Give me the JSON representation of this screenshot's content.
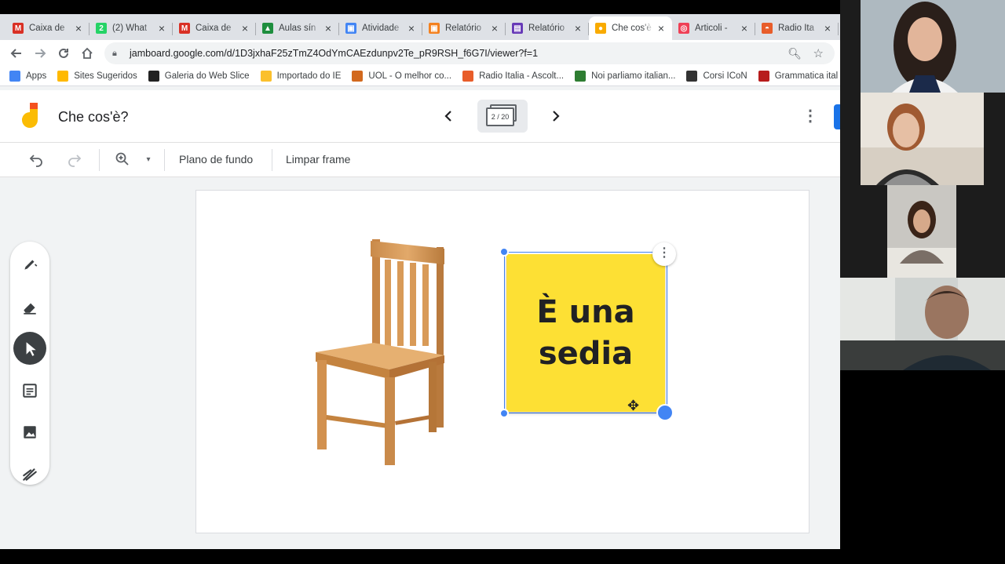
{
  "browser": {
    "tabs": [
      {
        "title": "Caixa de",
        "icon": "gmail-icon",
        "color": "#d93025",
        "glyph": "M",
        "active": false
      },
      {
        "title": "(2) What",
        "icon": "whatsapp-icon",
        "color": "#25d366",
        "glyph": "2",
        "active": false
      },
      {
        "title": "Caixa de",
        "icon": "gmail-icon",
        "color": "#d93025",
        "glyph": "M",
        "active": false
      },
      {
        "title": "Aulas sín",
        "icon": "drive-icon",
        "color": "#1e8e3e",
        "glyph": "▲",
        "active": false
      },
      {
        "title": "Atividade",
        "icon": "classroom-icon",
        "color": "#4285f4",
        "glyph": "▣",
        "active": false
      },
      {
        "title": "Relatório",
        "icon": "slides-icon",
        "color": "#f4811f",
        "glyph": "▣",
        "active": false
      },
      {
        "title": "Relatório",
        "icon": "forms-icon",
        "color": "#673ab7",
        "glyph": "▤",
        "active": false
      },
      {
        "title": "Che cos'è",
        "icon": "jamboard-icon",
        "color": "#f9ab00",
        "glyph": "●",
        "active": true
      },
      {
        "title": "Articoli -",
        "icon": "pocket-icon",
        "color": "#ef4056",
        "glyph": "◎",
        "active": false
      },
      {
        "title": "Radio Ita",
        "icon": "radio-italia-icon",
        "color": "#e85d2a",
        "glyph": "◓",
        "active": false
      }
    ],
    "url": "jamboard.google.com/d/1D3jxhaF25zTmZ4OdYmCAEzdunpv2Te_pR9RSH_f6G7I/viewer?f=1",
    "bookmarks": [
      {
        "label": "Apps",
        "icon": "apps-grid-icon",
        "color": "#4285f4"
      },
      {
        "label": "Sites Sugeridos",
        "icon": "bing-icon",
        "color": "#ffb900"
      },
      {
        "label": "Galeria do Web Slice",
        "icon": "web-slice-icon",
        "color": "#222222"
      },
      {
        "label": "Importado do IE",
        "icon": "folder-icon",
        "color": "#fbc02d"
      },
      {
        "label": "UOL - O melhor co...",
        "icon": "uol-icon",
        "color": "#d2691e"
      },
      {
        "label": "Radio Italia - Ascolt...",
        "icon": "radio-italia-icon",
        "color": "#e85d2a"
      },
      {
        "label": "Noi parliamo italian...",
        "icon": "leaf-icon",
        "color": "#2e7d32"
      },
      {
        "label": "Corsi ICoN",
        "icon": "globe-icon",
        "color": "#333333"
      },
      {
        "label": "Grammatica ital",
        "icon": "grammar-icon",
        "color": "#b71c1c"
      }
    ]
  },
  "jamboard": {
    "title": "Che cos'è?",
    "frame_counter": "2 / 20",
    "toolbar": {
      "background_label": "Plano de fundo",
      "clear_label": "Limpar frame"
    },
    "sticky_note": {
      "text": "È una\nsedia",
      "color": "#fde034"
    },
    "tools": [
      {
        "name": "pen-tool-icon",
        "selected": false
      },
      {
        "name": "eraser-tool-icon",
        "selected": false
      },
      {
        "name": "select-tool-icon",
        "selected": true
      },
      {
        "name": "sticky-note-tool-icon",
        "selected": false
      },
      {
        "name": "image-tool-icon",
        "selected": false
      },
      {
        "name": "laser-tool-icon",
        "selected": false
      }
    ]
  },
  "colors": {
    "accent": "#4285f4",
    "sticky": "#fde034",
    "share": "#1a73e8"
  }
}
